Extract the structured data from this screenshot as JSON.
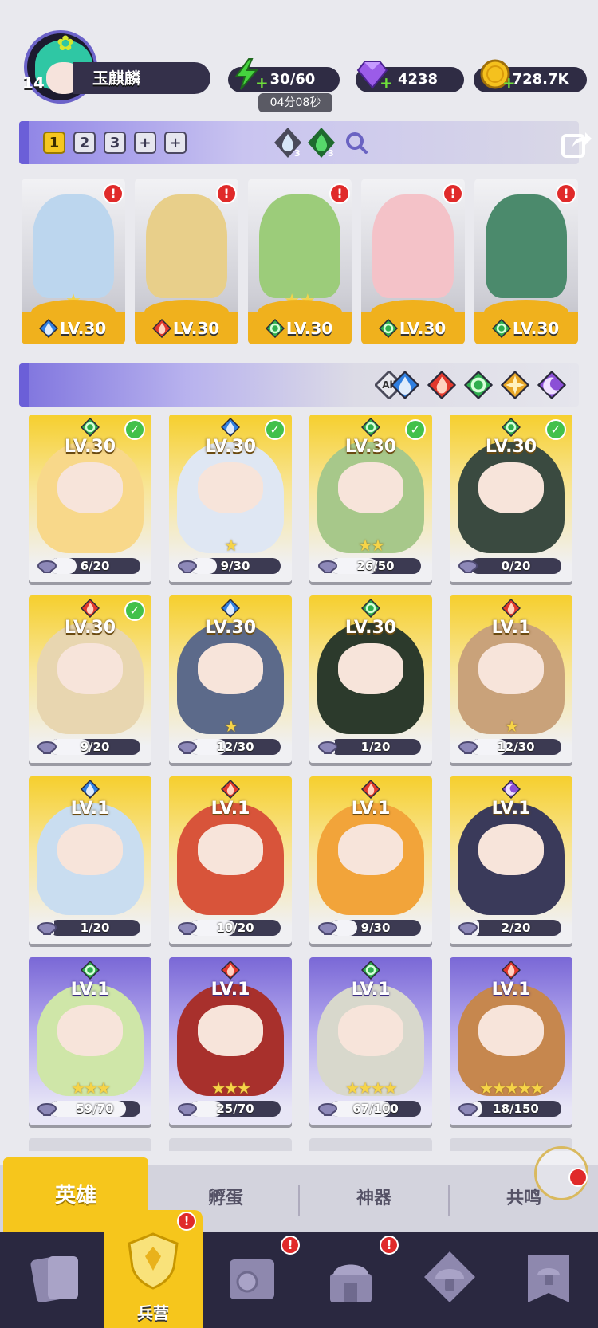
{
  "player": {
    "level": "14",
    "name": "玉麒麟"
  },
  "resources": {
    "energy": "30/60",
    "energy_timer": "04分08秒",
    "gems": "4238",
    "gold": "728.7K"
  },
  "team_bar": {
    "slots": [
      "1",
      "2",
      "3",
      "+",
      "+"
    ],
    "active_slot": "1",
    "water_drop_count": "3",
    "green_drop_count": "3"
  },
  "team": [
    {
      "level": "LV.30",
      "element": "water",
      "color": "#bcd6ee",
      "alert": "!",
      "stars": "★"
    },
    {
      "level": "LV.30",
      "element": "fire",
      "color": "#e8cf8a",
      "alert": "!",
      "stars": ""
    },
    {
      "level": "LV.30",
      "element": "nature",
      "color": "#9ccc7a",
      "alert": "!",
      "stars": "★★"
    },
    {
      "level": "LV.30",
      "element": "nature",
      "color": "#f4c2c8",
      "alert": "!",
      "stars": ""
    },
    {
      "level": "LV.30",
      "element": "nature",
      "color": "#4b8a6c",
      "alert": "!",
      "stars": ""
    }
  ],
  "filters": {
    "all_label": "All",
    "elements": [
      "water",
      "fire",
      "nature",
      "light",
      "dark"
    ]
  },
  "heroes": [
    {
      "level": "LV.30",
      "element": "nature",
      "progress": "6/20",
      "fill": 0.3,
      "owned": true,
      "theme": "gold",
      "art": "#f8d88a",
      "stars": ""
    },
    {
      "level": "LV.30",
      "element": "water",
      "progress": "9/30",
      "fill": 0.3,
      "owned": true,
      "theme": "gold",
      "art": "#dfe7f3",
      "stars": "★"
    },
    {
      "level": "LV.30",
      "element": "nature",
      "progress": "26/50",
      "fill": 0.52,
      "owned": true,
      "theme": "gold",
      "art": "#a7c88a",
      "stars": "★★"
    },
    {
      "level": "LV.30",
      "element": "nature",
      "progress": "0/20",
      "fill": 0.0,
      "owned": true,
      "theme": "gold",
      "art": "#3a4a40",
      "stars": ""
    },
    {
      "level": "LV.30",
      "element": "fire",
      "progress": "9/20",
      "fill": 0.45,
      "owned": true,
      "theme": "gold",
      "art": "#e8d6b0",
      "stars": ""
    },
    {
      "level": "LV.30",
      "element": "water",
      "progress": "12/30",
      "fill": 0.4,
      "owned": false,
      "theme": "gold",
      "art": "#5c6a8a",
      "stars": "★"
    },
    {
      "level": "LV.30",
      "element": "nature",
      "progress": "1/20",
      "fill": 0.05,
      "owned": false,
      "theme": "gold",
      "art": "#2c3a2c",
      "stars": ""
    },
    {
      "level": "LV.1",
      "element": "fire",
      "progress": "12/30",
      "fill": 0.4,
      "owned": false,
      "theme": "gold",
      "art": "#c9a27a",
      "stars": "★"
    },
    {
      "level": "LV.1",
      "element": "water",
      "progress": "1/20",
      "fill": 0.05,
      "owned": false,
      "theme": "gold",
      "art": "#c9ddf0",
      "stars": ""
    },
    {
      "level": "LV.1",
      "element": "fire",
      "progress": "10/20",
      "fill": 0.5,
      "owned": false,
      "theme": "gold",
      "art": "#d8543a",
      "stars": ""
    },
    {
      "level": "LV.1",
      "element": "fire",
      "progress": "9/30",
      "fill": 0.3,
      "owned": false,
      "theme": "gold",
      "art": "#f2a43a",
      "stars": ""
    },
    {
      "level": "LV.1",
      "element": "dark",
      "progress": "2/20",
      "fill": 0.1,
      "owned": false,
      "theme": "gold",
      "art": "#3a3a5a",
      "stars": ""
    },
    {
      "level": "LV.1",
      "element": "nature",
      "progress": "59/70",
      "fill": 0.84,
      "owned": false,
      "theme": "purple",
      "art": "#cfe6a8",
      "stars": "★★★"
    },
    {
      "level": "LV.1",
      "element": "fire",
      "progress": "25/70",
      "fill": 0.36,
      "owned": false,
      "theme": "purple",
      "art": "#a8302c",
      "stars": "★★★"
    },
    {
      "level": "LV.1",
      "element": "nature",
      "progress": "67/100",
      "fill": 0.67,
      "owned": false,
      "theme": "purple",
      "art": "#d8d8cc",
      "stars": "★★★★"
    },
    {
      "level": "LV.1",
      "element": "fire",
      "progress": "18/150",
      "fill": 0.12,
      "owned": false,
      "theme": "purple",
      "art": "#c6874e",
      "stars": "★★★★★"
    }
  ],
  "subtabs": [
    "英雄",
    "孵蛋",
    "神器",
    "共鸣"
  ],
  "nav": {
    "barracks_label": "兵营",
    "alerts": [
      "!",
      "!",
      "!"
    ]
  },
  "colors": {
    "water": "#2f7fe0",
    "fire": "#e2382c",
    "nature": "#2fae4e",
    "light": "#e8a626",
    "dark": "#8b4fd6"
  }
}
